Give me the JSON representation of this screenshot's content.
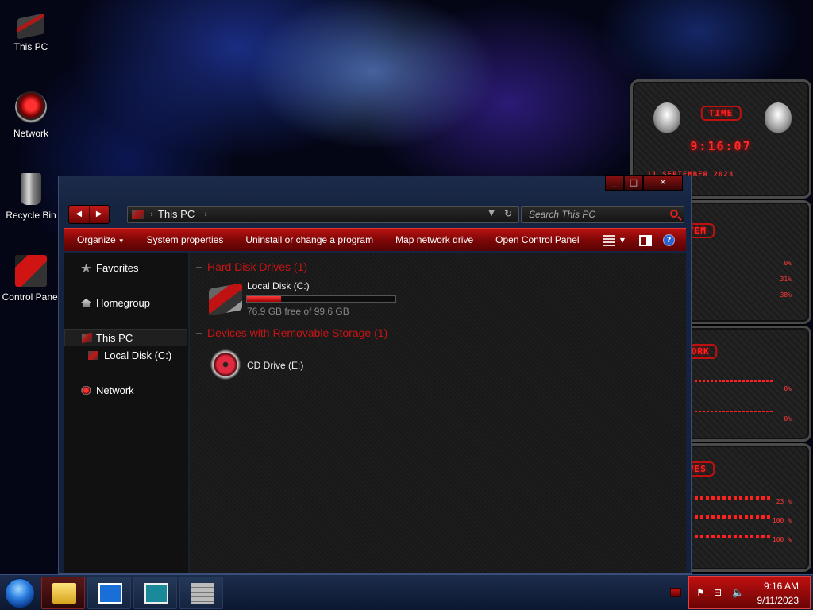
{
  "desktop": {
    "icons": [
      {
        "label": "This PC",
        "icon": "this-pc-icon"
      },
      {
        "label": "Network",
        "icon": "network-icon"
      },
      {
        "label": "Recycle Bin",
        "icon": "recycle-bin-icon"
      },
      {
        "label": "Control Panel",
        "icon": "control-panel-icon"
      }
    ]
  },
  "gadgets": {
    "time_title": "TIME",
    "time_value": "9:16:07",
    "date_strip": "11 SEPTEMBER 2023",
    "system_title": "SYSTEM",
    "system_values": [
      "0%",
      "31%",
      "38%"
    ],
    "network_title": "NETWORK",
    "network_values": [
      "0%",
      "0%"
    ],
    "drives_title": "DRIVES",
    "drives_values": [
      "23 %",
      "100 %",
      "100 %"
    ]
  },
  "window": {
    "address": {
      "location": "This PC"
    },
    "search_placeholder": "Search This PC",
    "command_bar": {
      "organize": "Organize",
      "system_properties": "System properties",
      "uninstall": "Uninstall or change a program",
      "map_drive": "Map network drive",
      "control_panel": "Open Control Panel"
    },
    "nav": {
      "favorites": "Favorites",
      "homegroup": "Homegroup",
      "this_pc": "This PC",
      "local_disk": "Local Disk (C:)",
      "network": "Network"
    },
    "groups": {
      "hdd": "Hard Disk Drives (1)",
      "removable": "Devices with Removable Storage (1)"
    },
    "drives": {
      "c": {
        "name": "Local Disk (C:)",
        "free_text": "76.9 GB free of 99.6 GB",
        "used_fraction": 0.228
      },
      "e": {
        "name": "CD Drive (E:)"
      }
    }
  },
  "taskbar": {
    "time": "9:16 AM",
    "date": "9/11/2023"
  },
  "colors": {
    "accent_red": "#c81414",
    "taskbar_blue": "#1c2c4c"
  }
}
